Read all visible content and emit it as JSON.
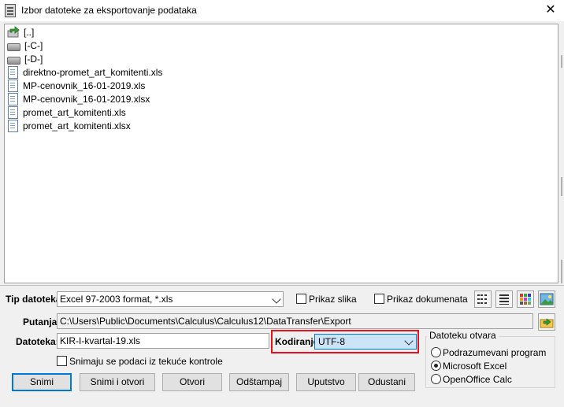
{
  "window": {
    "title": "Izbor datoteke za eksportovanje podataka",
    "close_glyph": "✕"
  },
  "files": [
    {
      "name": "[..]",
      "icon": "up-folder-icon"
    },
    {
      "name": "[-C-]",
      "icon": "drive-icon"
    },
    {
      "name": "[-D-]",
      "icon": "drive-icon"
    },
    {
      "name": "direktno-promet_art_komitenti.xls",
      "icon": "document-icon"
    },
    {
      "name": "MP-cenovnik_16-01-2019.xls",
      "icon": "document-icon"
    },
    {
      "name": "MP-cenovnik_16-01-2019.xlsx",
      "icon": "document-icon"
    },
    {
      "name": "promet_art_komitenti.xls",
      "icon": "document-icon"
    },
    {
      "name": "promet_art_komitenti.xlsx",
      "icon": "document-icon"
    }
  ],
  "filetype": {
    "label": "Tip datoteka:",
    "value": "Excel 97-2003 format, *.xls"
  },
  "options": {
    "show_images": "Prikaz slika",
    "show_documents": "Prikaz dokumenata",
    "save_from_current": "Snimaju se podaci iz tekuće kontrole"
  },
  "path": {
    "label": "Putanja:",
    "value": "C:\\Users\\Public\\Documents\\Calculus\\Calculus12\\DataTransfer\\Export"
  },
  "file": {
    "label": "Datoteka:",
    "value": "KIR-I-kvartal-19.xls"
  },
  "encoding": {
    "label": "Kodiranje:",
    "value": "UTF-8"
  },
  "open_with": {
    "title": "Datoteku otvara",
    "options": [
      "Podrazumevani program",
      "Microsoft Excel",
      "OpenOffice Calc"
    ],
    "selected": 1
  },
  "buttons": {
    "save": "Snimi",
    "save_open": "Snimi i otvori",
    "open": "Otvori",
    "print": "Odštampaj",
    "help": "Uputstvo",
    "cancel": "Odustani"
  },
  "colors": {
    "highlight": "#e8101c",
    "accent": "#0078d7"
  }
}
